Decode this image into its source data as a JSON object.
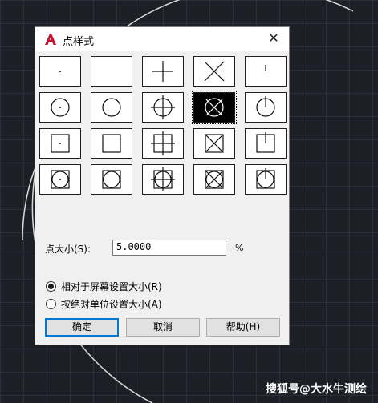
{
  "dialog": {
    "title": "点样式",
    "app_icon": "autocad-logo-icon",
    "close_icon": "close-icon",
    "close_glyph": "✕"
  },
  "styles": [
    {
      "name": "dot",
      "selected": false
    },
    {
      "name": "none",
      "selected": false
    },
    {
      "name": "plus",
      "selected": false
    },
    {
      "name": "cross",
      "selected": false
    },
    {
      "name": "tick",
      "selected": false
    },
    {
      "name": "circle-dot",
      "selected": false
    },
    {
      "name": "circle",
      "selected": false
    },
    {
      "name": "circle-plus",
      "selected": false
    },
    {
      "name": "circle-cross",
      "selected": true
    },
    {
      "name": "circle-tick",
      "selected": false
    },
    {
      "name": "square-dot",
      "selected": false
    },
    {
      "name": "square",
      "selected": false
    },
    {
      "name": "square-plus",
      "selected": false
    },
    {
      "name": "square-cross",
      "selected": false
    },
    {
      "name": "square-tick",
      "selected": false
    },
    {
      "name": "square-circle-dot",
      "selected": false
    },
    {
      "name": "square-circle",
      "selected": false
    },
    {
      "name": "square-circle-plus",
      "selected": false
    },
    {
      "name": "square-circle-cross",
      "selected": false
    },
    {
      "name": "square-circle-tick",
      "selected": false
    }
  ],
  "size": {
    "label": "点大小(S):",
    "value": "5.0000",
    "unit": "%"
  },
  "radios": [
    {
      "label": "相对于屏幕设置大小(R)",
      "checked": true
    },
    {
      "label": "按绝对单位设置大小(A)",
      "checked": false
    }
  ],
  "buttons": {
    "ok": "确定",
    "cancel": "取消",
    "help": "帮助(H)"
  },
  "watermark": "搜狐号@大水牛测绘",
  "colors": {
    "accent": "#0078d7",
    "logo_red": "#c8102e"
  }
}
